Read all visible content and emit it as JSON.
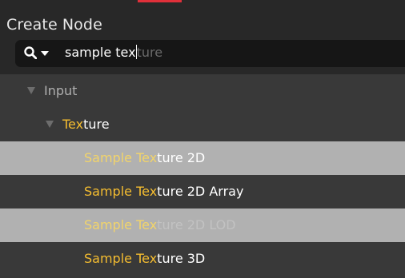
{
  "window": {
    "title": "Create Node"
  },
  "search": {
    "typed": "sample tex",
    "suggestion": "ture"
  },
  "tree": {
    "category": {
      "label": "Input"
    },
    "subcategory": {
      "match": "Tex",
      "rest": "ture"
    },
    "items": [
      {
        "match": "Sample Tex",
        "rest": "ture 2D",
        "state": "highlighted"
      },
      {
        "match": "Sample Tex",
        "rest": "ture 2D Array",
        "state": "normal"
      },
      {
        "match": "Sample Tex",
        "rest": "ture 2D LOD",
        "state": "highlighted"
      },
      {
        "match": "Sample Tex",
        "rest": "ture 3D",
        "state": "normal"
      }
    ]
  },
  "colors": {
    "match_highlight": "#f5bd30",
    "selected_row": "#b1b1b1",
    "panel": "#383838",
    "header": "#282828",
    "search_field": "#161616",
    "top_accent": "#e0303a"
  }
}
